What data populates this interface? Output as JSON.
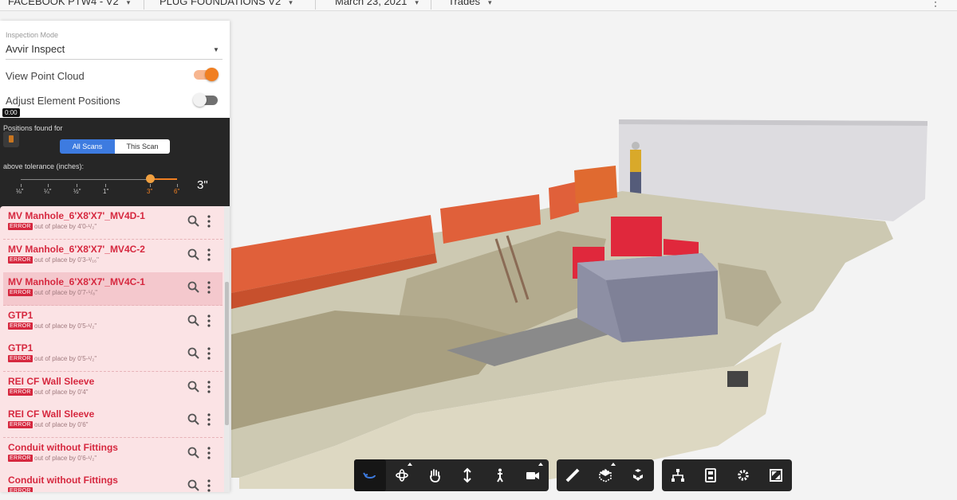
{
  "header": {
    "project": "FACEBOOK PTW4 - V2",
    "area": "PLUG FOUNDATIONS V2",
    "date": "March 23, 2021",
    "view": "Trades",
    "menu_icon": "more-vert-icon"
  },
  "panel": {
    "inspection_mode_label": "Inspection Mode",
    "inspection_mode_value": "Avvir Inspect",
    "view_point_cloud_label": "View Point Cloud",
    "view_point_cloud_on": true,
    "adjust_positions_label": "Adjust Element Positions",
    "adjust_positions_on": false,
    "timestamp": "0:00",
    "positions_found_label": "Positions found for",
    "scope_tabs": [
      "All Scans",
      "This Scan"
    ],
    "scope_active": "All Scans",
    "tolerance_label": "above tolerance (inches):",
    "tolerance_ticks": [
      "⅛\"",
      "¼\"",
      "½\"",
      "1\"",
      "3\"",
      "6\""
    ],
    "tolerance_value": "3\"",
    "tolerance_fraction": 0.82
  },
  "elements": [
    {
      "name": "MV Manhole_6'X8'X7'_MV4D-1",
      "status": "ERROR",
      "detail": "out of place by 4'0-¹/₂\""
    },
    {
      "name": "MV Manhole_6'X8'X7'_MV4C-2",
      "status": "ERROR",
      "detail": "out of place by 0'3-³/₁₆\""
    },
    {
      "name": "MV Manhole_6'X8'X7'_MV4C-1",
      "status": "ERROR",
      "detail": "out of place by 0'7-⁵/₈\""
    },
    {
      "name": "GTP1",
      "status": "ERROR",
      "detail": "out of place by 0'5-¹/₂\""
    },
    {
      "name": "GTP1",
      "status": "ERROR",
      "detail": "out of place by 0'5-¹/₂\""
    },
    {
      "name": "REI CF Wall Sleeve",
      "status": "ERROR",
      "detail": "out of place by 0'4\""
    },
    {
      "name": "REI CF Wall Sleeve",
      "status": "ERROR",
      "detail": "out of place by 0'6\""
    },
    {
      "name": "Conduit without Fittings",
      "status": "ERROR",
      "detail": "out of place by 0'6-¹/₂\""
    },
    {
      "name": "Conduit without Fittings",
      "status": "ERROR",
      "detail": ""
    }
  ],
  "toolbar": {
    "groups": [
      [
        "orbit-rotate-icon",
        "rotate-3d-icon",
        "pan-hand-icon",
        "vertical-move-icon",
        "walk-person-icon",
        "camera-icon"
      ],
      [
        "measure-ruler-icon",
        "section-box-icon",
        "explode-cubes-icon"
      ],
      [
        "model-tree-icon",
        "properties-icon",
        "settings-gear-icon",
        "fullscreen-icon"
      ]
    ]
  },
  "colors": {
    "accent_orange": "#f07f22",
    "error_red": "#d6283f",
    "active_blue": "#3d7be0"
  }
}
